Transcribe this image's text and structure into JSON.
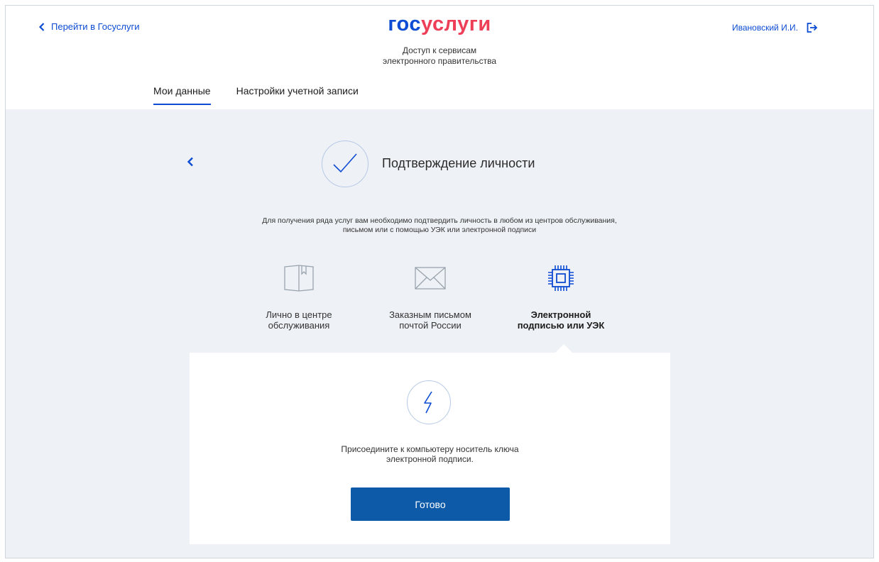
{
  "header": {
    "back_link": "Перейти в Госуслуги",
    "logo_part1": "гос",
    "logo_part2": "услуги",
    "tagline_line1": "Доступ к сервисам",
    "tagline_line2": "электронного правительства",
    "user_name": "Ивановский И.И."
  },
  "tabs": [
    {
      "label": "Мои данные",
      "active": true
    },
    {
      "label": "Настройки учетной записи",
      "active": false
    }
  ],
  "main": {
    "title": "Подтверждение личности",
    "intro_line1": "Для получения ряда услуг вам необходимо подтвердить личность в любом из центров обслуживания,",
    "intro_line2": "письмом или с помощью УЭК или электронной подписи",
    "methods": [
      {
        "line1": "Лично в центре",
        "line2": "обслуживания",
        "icon": "book-icon",
        "active": false
      },
      {
        "line1": "Заказным письмом",
        "line2": "почтой России",
        "icon": "envelope-icon",
        "active": false
      },
      {
        "line1": "Электронной",
        "line2": "подписью или УЭК",
        "icon": "chip-icon",
        "active": true
      }
    ],
    "card": {
      "text_line1": "Присоедините к компьютеру носитель ключа",
      "text_line2": "электронной подписи.",
      "button_label": "Готово",
      "icon": "lightning-icon"
    }
  },
  "colors": {
    "brand_blue": "#0d4cd3",
    "brand_red": "#ee3f58",
    "button_blue": "#0c5aa8",
    "background": "#eef1f5"
  }
}
